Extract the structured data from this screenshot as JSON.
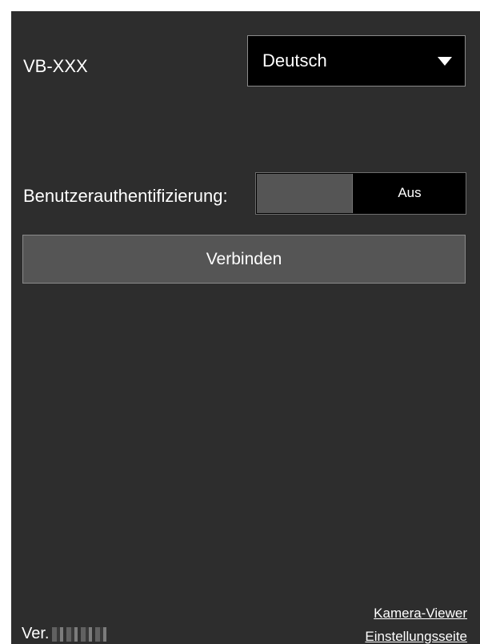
{
  "header": {
    "model_name": "VB-XXX",
    "language": {
      "selected": "Deutsch",
      "caret_icon": "triangle-down-icon"
    }
  },
  "auth": {
    "label": "Benutzerauthentifizierung:",
    "toggle_state": "Aus"
  },
  "actions": {
    "connect_label": "Verbinden"
  },
  "footer": {
    "version_prefix": "Ver.",
    "links": {
      "camera_viewer": "Kamera-Viewer",
      "settings_page": "Einstellungsseite"
    }
  },
  "colors": {
    "panel_background": "#2d2d2d",
    "control_background": "#000000",
    "button_background": "#555555",
    "text": "#ffffff"
  }
}
